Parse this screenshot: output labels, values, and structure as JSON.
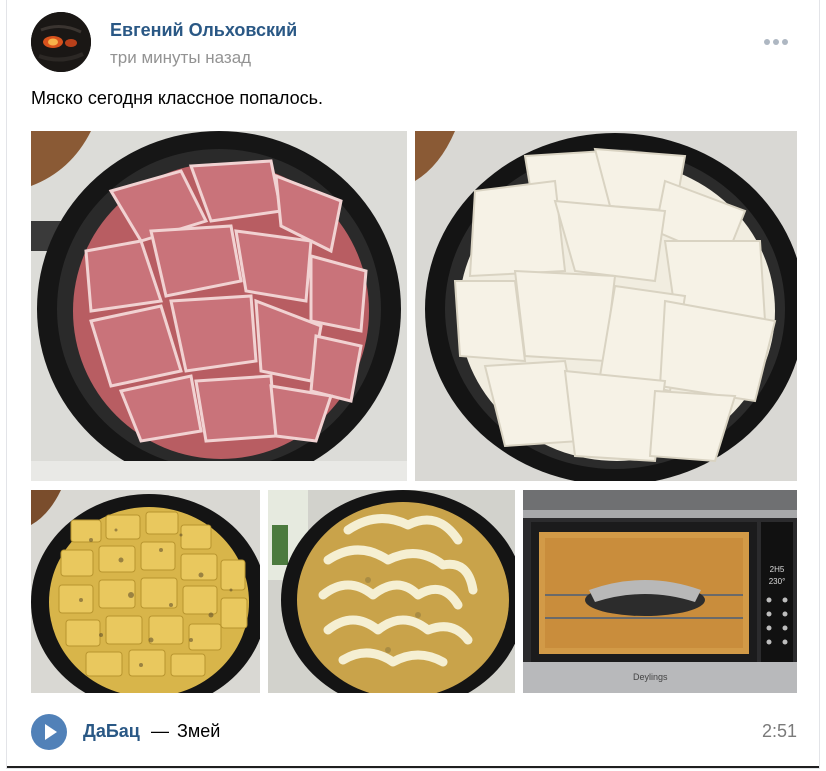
{
  "post": {
    "author": "Евгений Ольховский",
    "time": "три минуты назад",
    "text": "Мяско сегодня классное попалось.",
    "more_icon": "more-horizontal-icon"
  },
  "photos": [
    {
      "subject": "raw-pork-in-pan"
    },
    {
      "subject": "cheese-slices-in-pan"
    },
    {
      "subject": "potatoes-with-spices"
    },
    {
      "subject": "mayonnaise-on-potatoes"
    },
    {
      "subject": "dish-in-oven"
    }
  ],
  "oven": {
    "brand": "Deylings",
    "display_top": "2H5",
    "display_bottom": "230°"
  },
  "audio": {
    "artist": "ДаБац",
    "dash": "—",
    "title": "Змей",
    "duration": "2:51",
    "play_icon": "play-icon"
  },
  "colors": {
    "link": "#2a5885",
    "muted": "#939393",
    "play_button": "#5181b8"
  }
}
